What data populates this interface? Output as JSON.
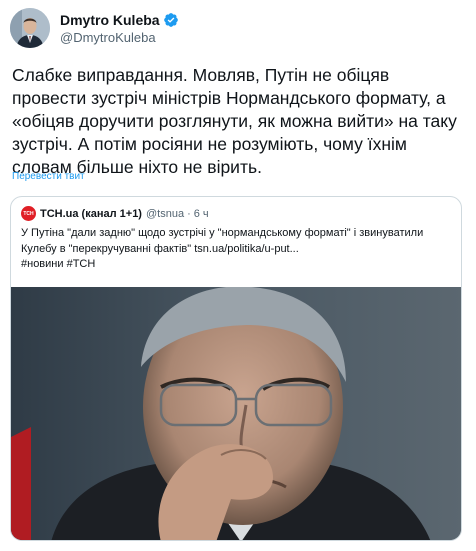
{
  "author": {
    "display_name": "Dmytro Kuleba",
    "handle": "@DmytroKuleba",
    "verified": true
  },
  "tweet": {
    "text": "Слабке виправдання. Мовляв, Путін не обіцяв провести зустріч міністрів Нормандського формату, а «обіцяв доручити розглянути, як можна вийти» на таку зустріч. А потім росіяни не розуміють, чому їхнім словам більше ніхто не вірить.",
    "translate_label": "Перевести твит"
  },
  "quote": {
    "avatar_text": "ТСН",
    "display_name": "TCH.ua (канал 1+1)",
    "handle": "@tsnua",
    "separator": "·",
    "time": "6 ч",
    "text": "У Путіна \"дали задню\" щодо зустрічі у \"нормандському форматі\" і звинуватили Кулебу в \"перекручуванні фактів\" tsn.ua/politika/u-put...",
    "hashtags": "#новини #ТСН"
  },
  "colors": {
    "link": "#1d9bf0",
    "verified": "#1d9bf0",
    "secondary_text": "#536471",
    "border": "#cfd9de",
    "tsn_red": "#e01f26"
  }
}
